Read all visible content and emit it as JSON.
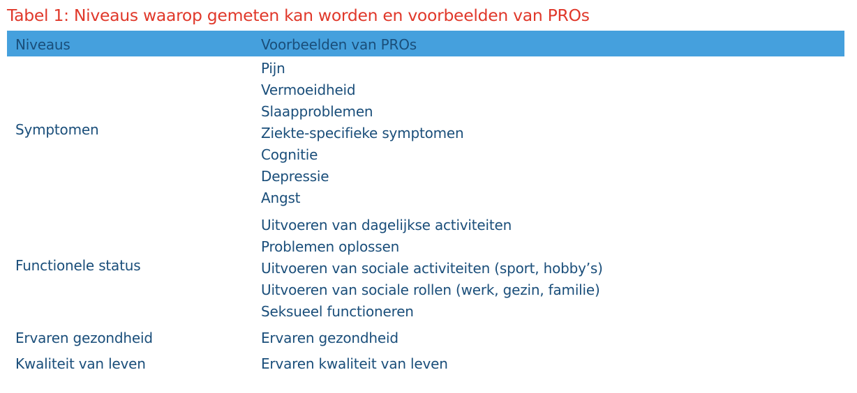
{
  "caption": "Tabel 1: Niveaus waarop gemeten kan worden en voorbeelden van PROs",
  "header": {
    "col_levels": "Niveaus",
    "col_examples": "Voorbeelden van PROs"
  },
  "rows": [
    {
      "level": "Symptomen",
      "examples": [
        "Pijn",
        "Vermoeidheid",
        "Slaapproblemen",
        "Ziekte-specifieke symptomen",
        "Cognitie",
        "Depressie",
        "Angst"
      ]
    },
    {
      "level": "Functionele status",
      "examples": [
        "Uitvoeren van dagelijkse activiteiten",
        "Problemen oplossen",
        "Uitvoeren van sociale activiteiten (sport, hobby’s)",
        "Uitvoeren van sociale rollen (werk, gezin, familie)",
        "Seksueel functioneren"
      ]
    },
    {
      "level": "Ervaren gezondheid",
      "examples": [
        "Ervaren gezondheid"
      ]
    },
    {
      "level": "Kwaliteit van leven",
      "examples": [
        "Ervaren kwaliteit van leven"
      ]
    }
  ],
  "colors": {
    "caption": "#e0382a",
    "header_bg": "#45a0dd",
    "text": "#1a4e7a"
  }
}
